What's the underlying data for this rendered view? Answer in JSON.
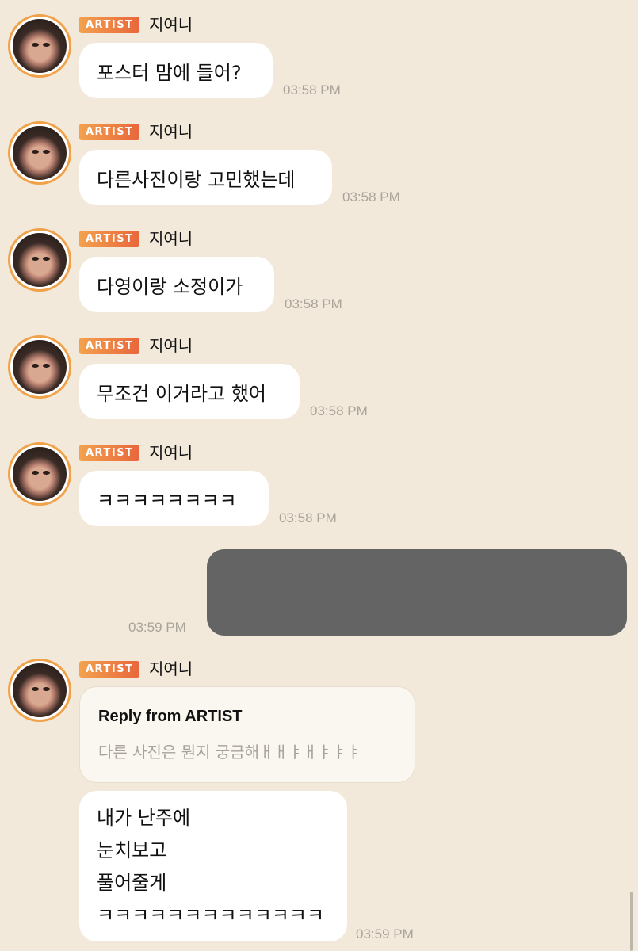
{
  "badge_label": "ARTIST",
  "sender_name": "지여니",
  "messages": [
    {
      "text": "포스터 맘에 들어?",
      "time": "03:58 PM"
    },
    {
      "text": "다른사진이랑 고민했는데",
      "time": "03:58 PM"
    },
    {
      "text": "다영이랑 소정이가",
      "time": "03:58 PM"
    },
    {
      "text": "무조건 이거라고 했어",
      "time": "03:58 PM"
    },
    {
      "text": "ㅋㅋㅋㅋㅋㅋㅋㅋ",
      "time": "03:58 PM"
    }
  ],
  "my_message": {
    "time": "03:59 PM"
  },
  "reply": {
    "title": "Reply from ARTIST",
    "quoted_text": "다른 사진은 뭔지 궁금해ㅐㅐㅑㅐㅑㅑㅑ",
    "lines": [
      "내가 난주에",
      "눈치보고",
      "풀어줄게",
      "ㅋㅋㅋㅋㅋㅋㅋㅋㅋㅋㅋㅋㅋ"
    ],
    "time": "03:59 PM"
  },
  "colors": {
    "background": "#f2e9da",
    "badge_start": "#f2a24e",
    "badge_end": "#e9663c",
    "avatar_ring": "#f0a24a",
    "my_bubble": "#646464"
  }
}
